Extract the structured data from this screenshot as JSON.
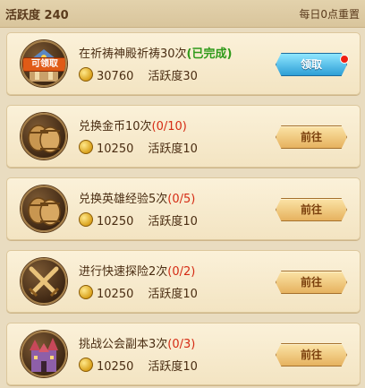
{
  "header": {
    "title": "活跃度 240",
    "reset": "每日0点重置"
  },
  "tasks": [
    {
      "name": "在祈祷神殿祈祷30次",
      "progress": "(已完成)",
      "gold": "30760",
      "activity": "活跃度30",
      "button": "领取",
      "icon": "temple-claim-icon",
      "icon_tag": "可领取"
    },
    {
      "name": "兑换金币10次",
      "progress": "(0/10)",
      "gold": "10250",
      "activity": "活跃度10",
      "button": "前往",
      "icon": "barrel-icon"
    },
    {
      "name": "兑换英雄经验5次",
      "progress": "(0/5)",
      "gold": "10250",
      "activity": "活跃度10",
      "button": "前往",
      "icon": "barrel-icon"
    },
    {
      "name": "进行快速探险2次",
      "progress": "(0/2)",
      "gold": "10250",
      "activity": "活跃度10",
      "button": "前往",
      "icon": "crossed-swords-icon"
    },
    {
      "name": "挑战公会副本3次",
      "progress": "(0/3)",
      "gold": "10250",
      "activity": "活跃度10",
      "button": "前往",
      "icon": "castle-icon"
    }
  ]
}
